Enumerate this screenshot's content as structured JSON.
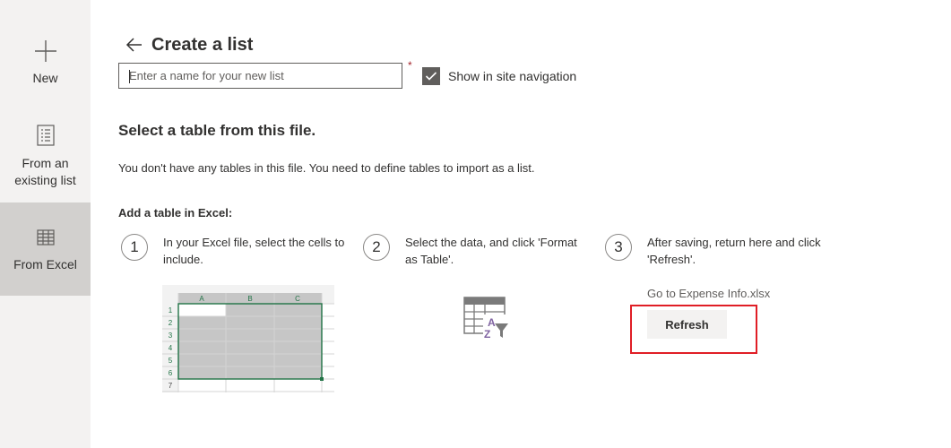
{
  "sidebar": {
    "items": [
      {
        "label": "New",
        "icon": "plus-icon"
      },
      {
        "label": "From an existing list",
        "icon": "list-icon"
      },
      {
        "label": "From Excel",
        "icon": "table-icon",
        "selected": true
      }
    ]
  },
  "header": {
    "title": "Create a list"
  },
  "form": {
    "name_placeholder": "Enter a name for your new list",
    "name_value": "",
    "required_marker": "*",
    "show_nav_label": "Show in site navigation",
    "show_nav_checked": true
  },
  "content": {
    "section_title": "Select a table from this file.",
    "info_text": "You don't have any tables in this file. You need to define tables to import as a list.",
    "add_title": "Add a table in Excel:",
    "steps": [
      {
        "number": "1",
        "text": "In your Excel file, select the cells to include."
      },
      {
        "number": "2",
        "text": "Select the data, and click 'Format as Table'."
      },
      {
        "number": "3",
        "text": "After saving, return here and click 'Refresh'."
      }
    ],
    "excel_preview": {
      "columns": [
        "A",
        "B",
        "C"
      ],
      "rows": [
        "1",
        "2",
        "3",
        "4",
        "5",
        "6",
        "7"
      ]
    },
    "format_icon_letters": {
      "top": "A",
      "bottom": "Z"
    },
    "goto_link": "Go to Expense Info.xlsx",
    "refresh_label": "Refresh"
  },
  "colors": {
    "sidebar_bg": "#f3f2f1",
    "sidebar_selected": "#d2d0ce",
    "excel_green": "#217346",
    "highlight": "#e01e26",
    "required": "#a4262c"
  }
}
